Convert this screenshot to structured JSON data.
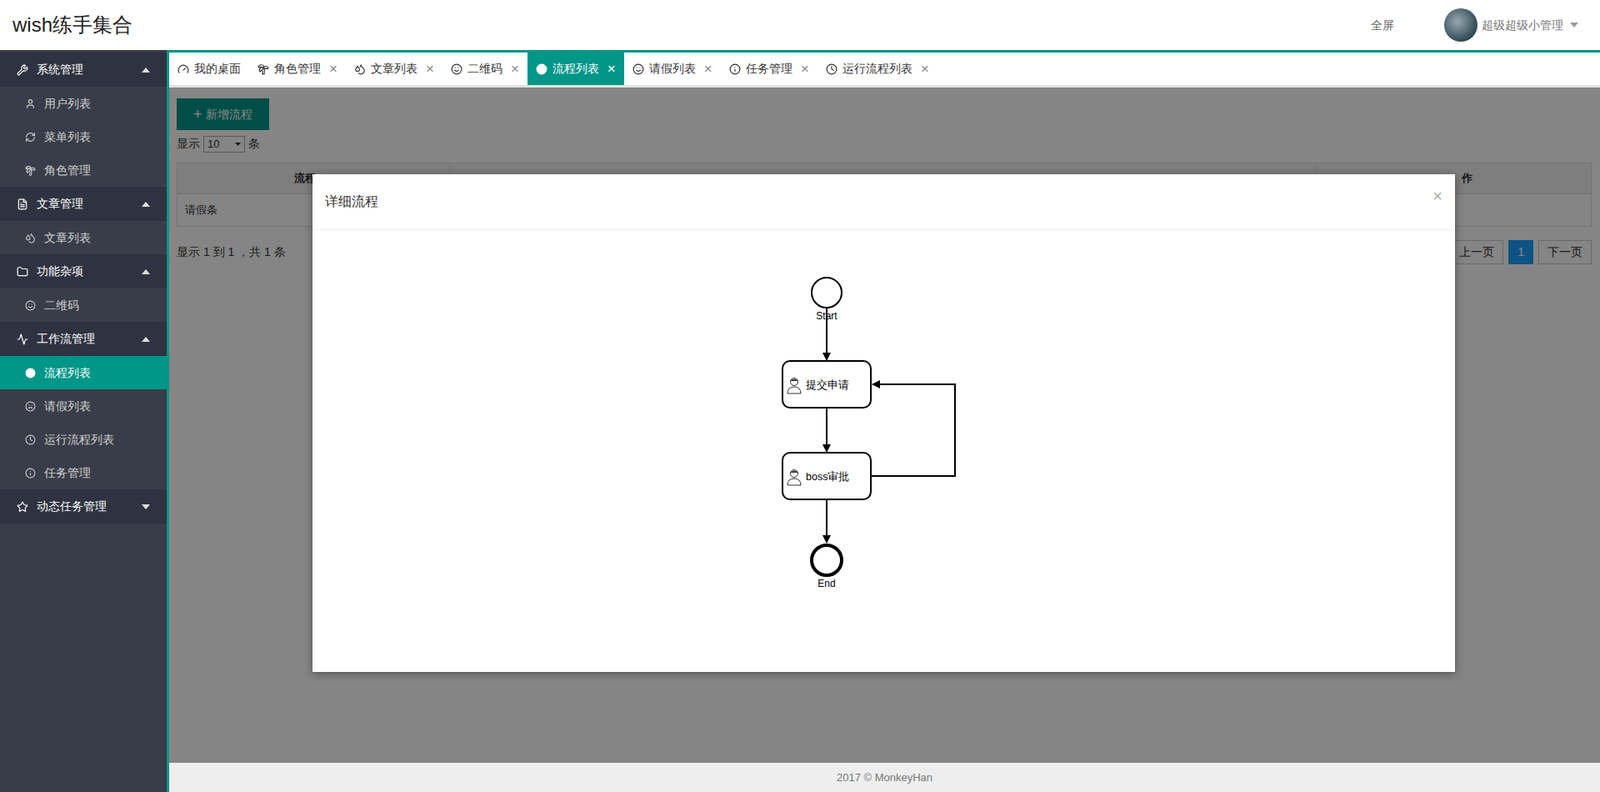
{
  "header": {
    "title": "wish练手集合",
    "fullscreen": "全屏",
    "user": "超级超级小管理"
  },
  "sidebar": {
    "sections": [
      {
        "label": "系统管理",
        "expanded": true,
        "items": [
          {
            "label": "用户列表",
            "selected": false
          },
          {
            "label": "菜单列表",
            "selected": false
          },
          {
            "label": "角色管理",
            "selected": false
          }
        ]
      },
      {
        "label": "文章管理",
        "expanded": true,
        "items": [
          {
            "label": "文章列表",
            "selected": false
          }
        ]
      },
      {
        "label": "功能杂项",
        "expanded": true,
        "items": [
          {
            "label": "二维码",
            "selected": false
          }
        ]
      },
      {
        "label": "工作流管理",
        "expanded": true,
        "items": [
          {
            "label": "流程列表",
            "selected": true
          },
          {
            "label": "请假列表",
            "selected": false
          },
          {
            "label": "运行流程列表",
            "selected": false
          },
          {
            "label": "任务管理",
            "selected": false
          }
        ]
      },
      {
        "label": "动态任务管理",
        "expanded": false,
        "items": []
      }
    ]
  },
  "tabs": {
    "close_glyph": "×",
    "items": [
      {
        "label": "我的桌面",
        "selected": false,
        "closable": false
      },
      {
        "label": "角色管理",
        "selected": false,
        "closable": true
      },
      {
        "label": "文章列表",
        "selected": false,
        "closable": true
      },
      {
        "label": "二维码",
        "selected": false,
        "closable": true
      },
      {
        "label": "流程列表",
        "selected": true,
        "closable": true
      },
      {
        "label": "请假列表",
        "selected": false,
        "closable": true
      },
      {
        "label": "任务管理",
        "selected": false,
        "closable": true
      },
      {
        "label": "运行流程列表",
        "selected": false,
        "closable": true
      }
    ]
  },
  "toolbar": {
    "add_button": "新增流程",
    "page_size_prefix": "显示",
    "page_size": "10",
    "page_size_suffix": "条"
  },
  "table": {
    "columns_visible": [
      "流程",
      "作"
    ],
    "rows": [
      [
        "请假条"
      ]
    ]
  },
  "summary": "显示 1 到 1 ，共 1 条",
  "pagination": {
    "prev": "上一页",
    "pages": [
      {
        "label": "1",
        "selected": true
      }
    ],
    "next": "下一页"
  },
  "modal": {
    "title": "详细流程",
    "close": "×",
    "nodes": [
      {
        "kind": "start",
        "label": "Start"
      },
      {
        "kind": "task",
        "label": "提交申请"
      },
      {
        "kind": "task",
        "label": "boss审批"
      },
      {
        "kind": "end",
        "label": "End"
      }
    ]
  },
  "footer": "2017 © MonkeyHan"
}
